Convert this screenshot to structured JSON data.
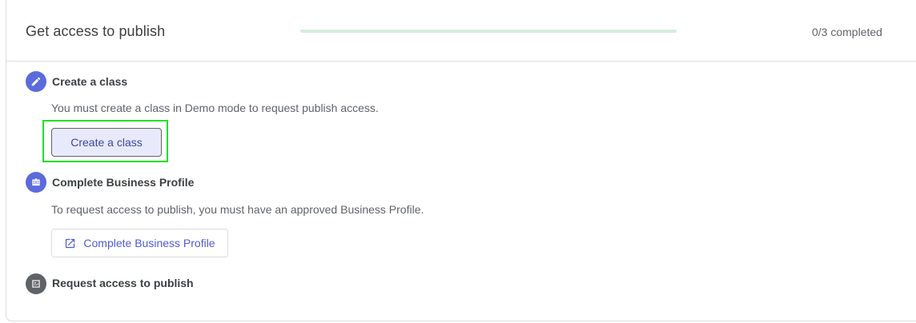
{
  "header": {
    "title": "Get access to publish",
    "progress_text": "0/3 completed",
    "progress_fraction": 0
  },
  "colors": {
    "step_active": "#5b6bdc",
    "step_inactive": "#5f6368",
    "progress_track": "#d7ecdc",
    "highlight": "#22e022"
  },
  "steps": [
    {
      "icon": "pencil-icon",
      "title": "Create a class",
      "description": "You must create a class in Demo mode to request publish access.",
      "button_label": "Create a class"
    },
    {
      "icon": "business-icon",
      "title": "Complete Business Profile",
      "description": "To request access to publish, you must have an approved Business Profile.",
      "button_label": "Complete Business Profile",
      "button_icon": "open-in-new-icon"
    },
    {
      "icon": "publish-request-icon",
      "title": "Request access to publish"
    }
  ]
}
